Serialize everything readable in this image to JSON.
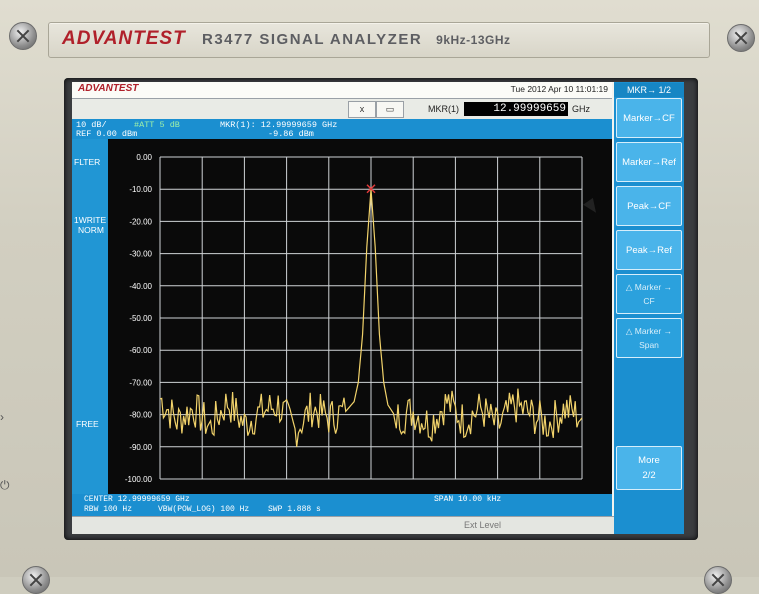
{
  "instrument": {
    "brand": "ADVANTEST",
    "model": "R3477  SIGNAL ANALYZER",
    "range": "9kHz-13GHz"
  },
  "screen": {
    "brand": "ADVANTEST",
    "datetime": "Tue 2012 Apr 10 11:01:19",
    "toolbar": {
      "close_label": "x",
      "window_label": "▭",
      "marker_label": "MKR(1)",
      "marker_value": "12.99999659",
      "marker_unit": "GHz"
    },
    "header": {
      "scale": "10 dB/",
      "ref": "REF 0.00  dBm",
      "att": "#ATT 5 dB",
      "marker_freq": "MKR(1): 12.99999659 GHz",
      "marker_level": "-9.86 dBm"
    },
    "left_labels": {
      "filter": "FLTER",
      "trace_mode": "1WRITE",
      "trace_det": "NORM",
      "free": "FREE"
    },
    "footer": {
      "center": "CENTER 12.99999659 GHz",
      "span": "SPAN 10.00 kHz",
      "rbw": "RBW 100 Hz",
      "vbw": "VBW(POW_LOG) 100 Hz",
      "swp": "SWP 1.888 s"
    },
    "status_tag": "Ext  Level",
    "softkeys": {
      "title": "MKR→ 1/2",
      "items": [
        {
          "label": "Marker→CF",
          "dim": false
        },
        {
          "label": "Marker→Ref",
          "dim": false
        },
        {
          "label": "Peak→CF",
          "dim": false
        },
        {
          "label": "Peak→Ref",
          "dim": false
        },
        {
          "label": "△ Marker →",
          "sub": "CF",
          "dim": true
        },
        {
          "label": "△ Marker →",
          "sub": "Span",
          "dim": true
        }
      ],
      "more_label": "More",
      "more_page": "2/2"
    }
  },
  "chart_data": {
    "type": "line",
    "title": "",
    "xlabel": "",
    "ylabel": "",
    "x_range": [
      0,
      100
    ],
    "ylim": [
      -100,
      0
    ],
    "y_ticks": [
      "0.00",
      "-10.00",
      "-20.00",
      "-30.00",
      "-40.00",
      "-50.00",
      "-60.00",
      "-70.00",
      "-80.00",
      "-90.00",
      "-100.00"
    ],
    "grid": true,
    "trace_color": "#f2d36b",
    "marker_color": "#e23b3b",
    "marker": {
      "x": 50,
      "y": -9.86
    },
    "series": [
      {
        "x": [
          0,
          4,
          8,
          12,
          16,
          20,
          24,
          28,
          32,
          36,
          40,
          44,
          46,
          47,
          48,
          49,
          50,
          51,
          52,
          53,
          54,
          56,
          60,
          64,
          68,
          72,
          76,
          80,
          84,
          88,
          92,
          96,
          100
        ],
        "y": [
          -75,
          -82,
          -78,
          -84,
          -76,
          -83,
          -79,
          -77,
          -85,
          -78,
          -81,
          -79,
          -76,
          -70,
          -55,
          -28,
          -10,
          -28,
          -55,
          -70,
          -77,
          -81,
          -79,
          -83,
          -76,
          -82,
          -78,
          -84,
          -77,
          -80,
          -83,
          -78,
          -81
        ]
      }
    ]
  }
}
